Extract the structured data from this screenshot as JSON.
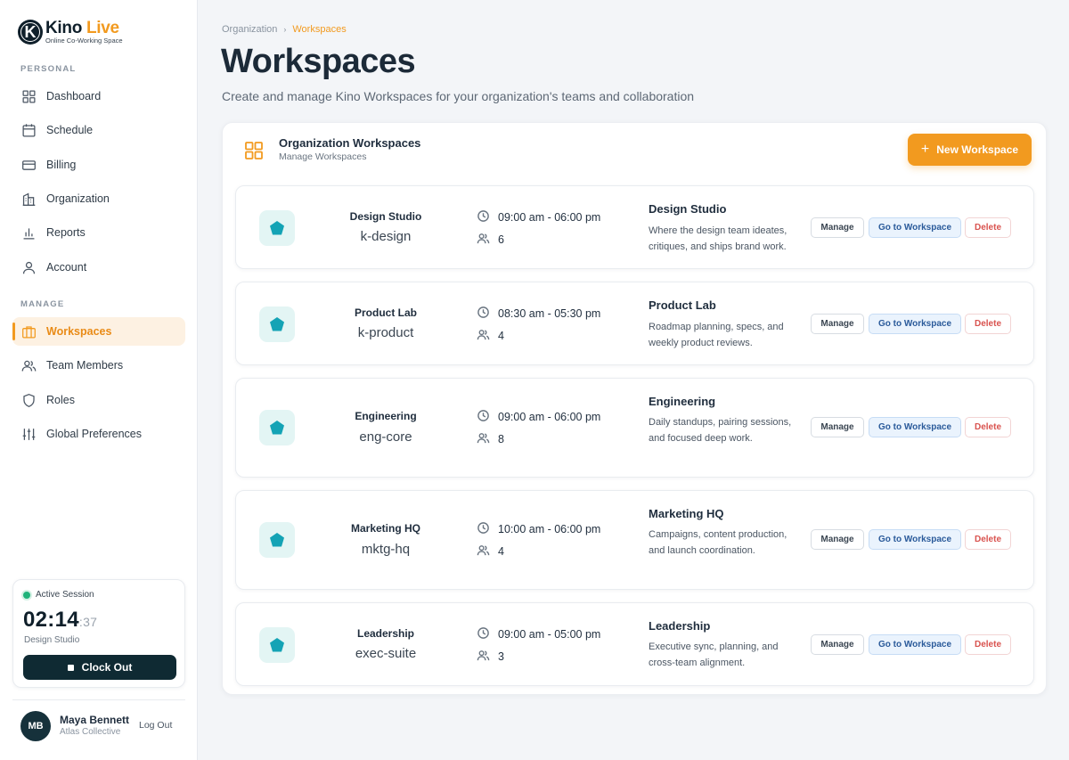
{
  "brand": {
    "name_part1": "Kino",
    "name_part2": "Live",
    "tagline": "Online Co-Working Space",
    "mark": "K"
  },
  "sidebar": {
    "personal_label": "PERSONAL",
    "personal_items": [
      {
        "label": "Dashboard",
        "icon": "dashboard-icon"
      },
      {
        "label": "Schedule",
        "icon": "calendar-icon"
      },
      {
        "label": "Billing",
        "icon": "credit-card-icon"
      },
      {
        "label": "Organization",
        "icon": "building-icon"
      },
      {
        "label": "Reports",
        "icon": "bar-chart-icon"
      },
      {
        "label": "Account",
        "icon": "user-icon"
      }
    ],
    "manage_label": "MANAGE",
    "manage_items": [
      {
        "label": "Workspaces",
        "icon": "briefcase-icon",
        "active": true
      },
      {
        "label": "Team Members",
        "icon": "users-icon"
      },
      {
        "label": "Roles",
        "icon": "shield-icon"
      },
      {
        "label": "Global Preferences",
        "icon": "sliders-icon"
      }
    ]
  },
  "session": {
    "status": "Active Session",
    "time_main": "02:14",
    "time_seconds": ":37",
    "workspace": "Design Studio",
    "clock_out_label": "Clock Out"
  },
  "user": {
    "initials": "MB",
    "name": "Maya Bennett",
    "org": "Atlas Collective",
    "logout_label": "Log Out"
  },
  "breadcrumb": {
    "parent": "Organization",
    "separator": "›",
    "current": "Workspaces"
  },
  "page": {
    "title": "Workspaces",
    "subtitle": "Create and manage Kino Workspaces for your organization's teams and collaboration"
  },
  "panel": {
    "title": "Organization Workspaces",
    "subtitle": "Manage Workspaces",
    "new_button": "New Workspace",
    "new_button_icon": "+"
  },
  "actions": {
    "manage": "Manage",
    "goto": "Go to Workspace",
    "delete": "Delete"
  },
  "colors": {
    "accent": "#f29a1f",
    "dark": "#0f2a33",
    "teal": "#14a3b5",
    "danger": "#d9534f",
    "link": "#2a5a9a"
  },
  "workspaces": [
    {
      "name": "Design Studio",
      "code": "k-design",
      "hours": "09:00 am - 06:00 pm",
      "members": "6",
      "title": "Design Studio",
      "description": "Where the design team ideates, critiques, and ships brand work."
    },
    {
      "name": "Product Lab",
      "code": "k-product",
      "hours": "08:30 am - 05:30 pm",
      "members": "4",
      "title": "Product Lab",
      "description": "Roadmap planning, specs, and weekly product reviews."
    },
    {
      "name": "Engineering",
      "code": "eng-core",
      "hours": "09:00 am - 06:00 pm",
      "members": "8",
      "title": "Engineering",
      "description": "Daily standups, pairing sessions, and focused deep work."
    },
    {
      "name": "Marketing HQ",
      "code": "mktg-hq",
      "hours": "10:00 am - 06:00 pm",
      "members": "4",
      "title": "Marketing HQ",
      "description": "Campaigns, content production, and launch coordination."
    },
    {
      "name": "Leadership",
      "code": "exec-suite",
      "hours": "09:00 am - 05:00 pm",
      "members": "3",
      "title": "Leadership",
      "description": "Executive sync, planning, and cross-team alignment."
    }
  ]
}
